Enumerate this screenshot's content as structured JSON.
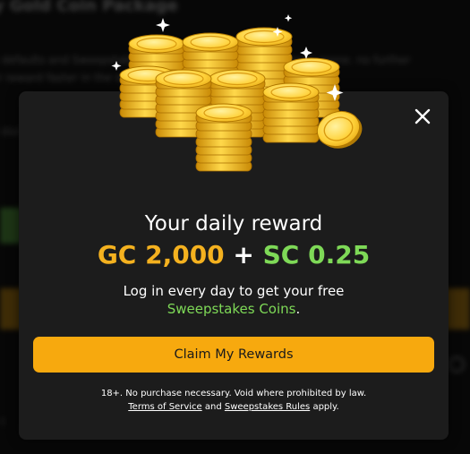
{
  "background": {
    "title": "ny Gold Coin Package",
    "line1": "it defaults and Sweepstakes Coins you can use in our promo game. no further",
    "line2": "ur reward faster in the store, offer, or limited offers",
    "line3": "d dial",
    "line4": "e t"
  },
  "modal": {
    "close_icon": "close-icon",
    "illustration": "gold-coin-stacks",
    "title": "Your daily reward",
    "gc_amount": "GC 2,000",
    "plus": "+",
    "sc_amount": "SC 0.25",
    "description_line1": "Log in every day to get your free",
    "description_green": "Sweepstakes Coins",
    "description_period": ".",
    "claim_button": "Claim My Rewards",
    "legal_line1": "18+. No purchase necessary. Void where prohibited by law.",
    "terms_link": "Terms of Service",
    "and_text": "and",
    "rules_link": "Sweepstakes Rules",
    "apply_text": "apply."
  },
  "colors": {
    "accent_gold": "#f7a90e",
    "gc_gold": "#f4b11f",
    "sc_green": "#7ed957",
    "modal_bg": "#1c1c1c"
  }
}
